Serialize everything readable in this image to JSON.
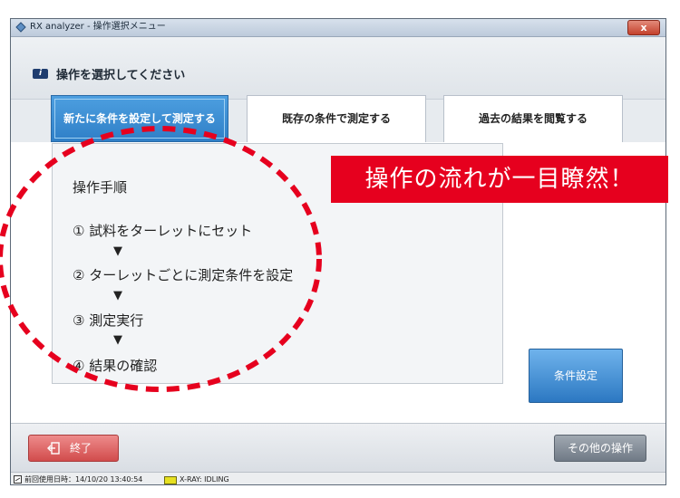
{
  "window": {
    "title": "RX analyzer - 操作選択メニュー",
    "close_label": "x"
  },
  "header": {
    "text": "操作を選択してください",
    "info_icon": "i"
  },
  "tabs": [
    {
      "label": "新たに条件を設定して測定する",
      "active": true
    },
    {
      "label": "既存の条件で測定する",
      "active": false
    },
    {
      "label": "過去の結果を閲覧する",
      "active": false
    }
  ],
  "steps": {
    "title": "操作手順",
    "items": [
      "① 試料をターレットにセット",
      "② ターレットごとに測定条件を設定",
      "③ 測定実行",
      "④ 結果の確認"
    ],
    "arrow": "▼"
  },
  "callout": {
    "text": "操作の流れが一目瞭然！",
    "color": "#e6001e"
  },
  "buttons": {
    "condition_setting": "条件設定",
    "exit": "終了",
    "other": "その他の操作"
  },
  "status": {
    "last_used": "前回使用日時：14/10/20 13:40:54",
    "xray": "X-RAY: IDLING"
  },
  "colors": {
    "accent": "#2f7fc7",
    "annotation": "#e6001e"
  },
  "icons": {
    "app": "app-logo-icon",
    "info": "info-icon",
    "exit": "exit-icon",
    "status": "status-icon"
  }
}
